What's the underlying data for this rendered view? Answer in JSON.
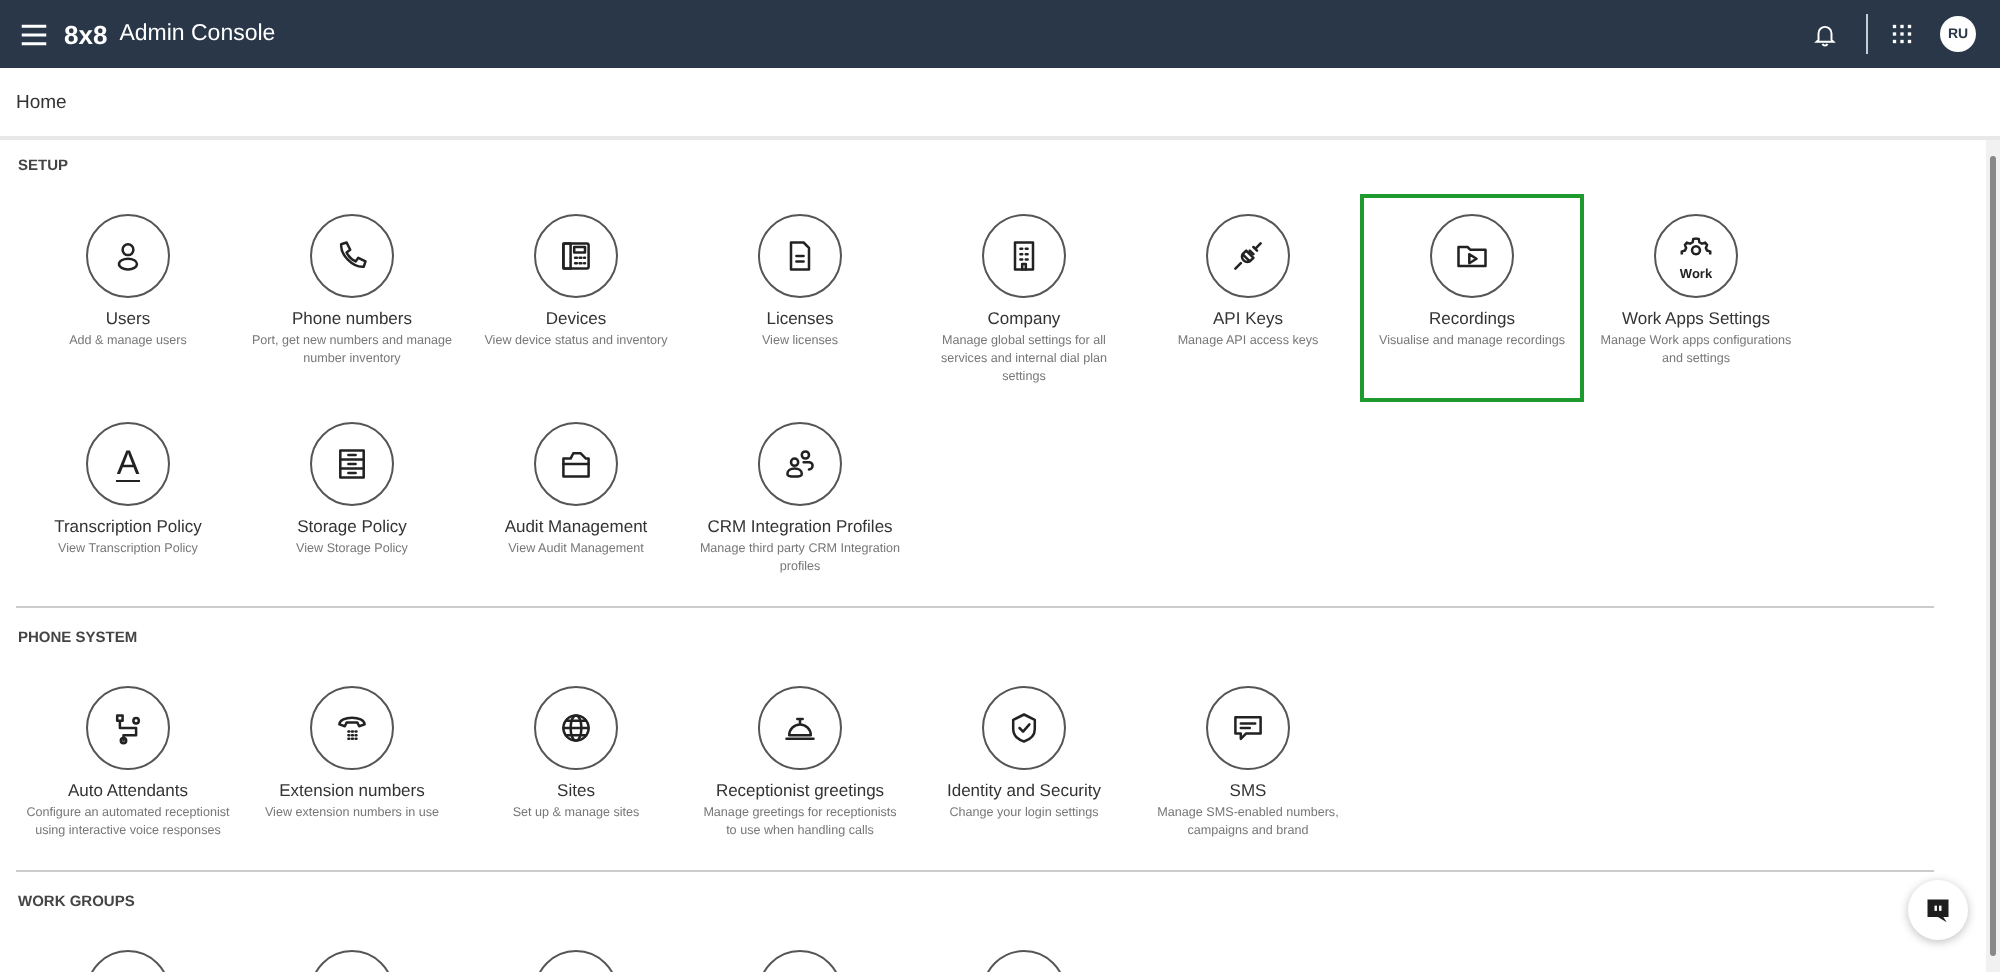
{
  "header": {
    "logo": "8x8",
    "title": "Admin Console",
    "avatar": "RU"
  },
  "breadcrumb": "Home",
  "sections": [
    {
      "title": "SETUP",
      "tiles": [
        {
          "title": "Users",
          "description": "Add & manage users",
          "highlighted": false
        },
        {
          "title": "Phone numbers",
          "description": "Port, get new numbers and manage number inventory",
          "highlighted": false
        },
        {
          "title": "Devices",
          "description": "View device status and inventory",
          "highlighted": false
        },
        {
          "title": "Licenses",
          "description": "View licenses",
          "highlighted": false
        },
        {
          "title": "Company",
          "description": "Manage global settings for all services and internal dial plan settings",
          "highlighted": false
        },
        {
          "title": "API Keys",
          "description": "Manage API access keys",
          "highlighted": false
        },
        {
          "title": "Recordings",
          "description": "Visualise and manage recordings",
          "highlighted": true
        },
        {
          "title": "Work Apps Settings",
          "description": "Manage Work apps configurations and settings",
          "highlighted": false,
          "icon_text": "Work"
        },
        {
          "title": "Transcription Policy",
          "description": "View Transcription Policy",
          "highlighted": false,
          "icon_text": "A"
        },
        {
          "title": "Storage Policy",
          "description": "View Storage Policy",
          "highlighted": false
        },
        {
          "title": "Audit Management",
          "description": "View Audit Management",
          "highlighted": false
        },
        {
          "title": "CRM Integration Profiles",
          "description": "Manage third party CRM Integration profiles",
          "highlighted": false
        }
      ]
    },
    {
      "title": "PHONE SYSTEM",
      "tiles": [
        {
          "title": "Auto Attendants",
          "description": "Configure an automated receptionist using interactive voice responses",
          "highlighted": false
        },
        {
          "title": "Extension numbers",
          "description": "View extension numbers in use",
          "highlighted": false
        },
        {
          "title": "Sites",
          "description": "Set up & manage sites",
          "highlighted": false
        },
        {
          "title": "Receptionist greetings",
          "description": "Manage greetings for receptionists to use when handling calls",
          "highlighted": false
        },
        {
          "title": "Identity and Security",
          "description": "Change your login settings",
          "highlighted": false
        },
        {
          "title": "SMS",
          "description": "Manage SMS-enabled numbers, campaigns and brand",
          "highlighted": false
        }
      ]
    },
    {
      "title": "WORK GROUPS",
      "tiles": [
        {
          "highlighted": false
        },
        {
          "highlighted": false
        },
        {
          "highlighted": false
        },
        {
          "highlighted": false
        },
        {
          "highlighted": false
        }
      ]
    }
  ]
}
